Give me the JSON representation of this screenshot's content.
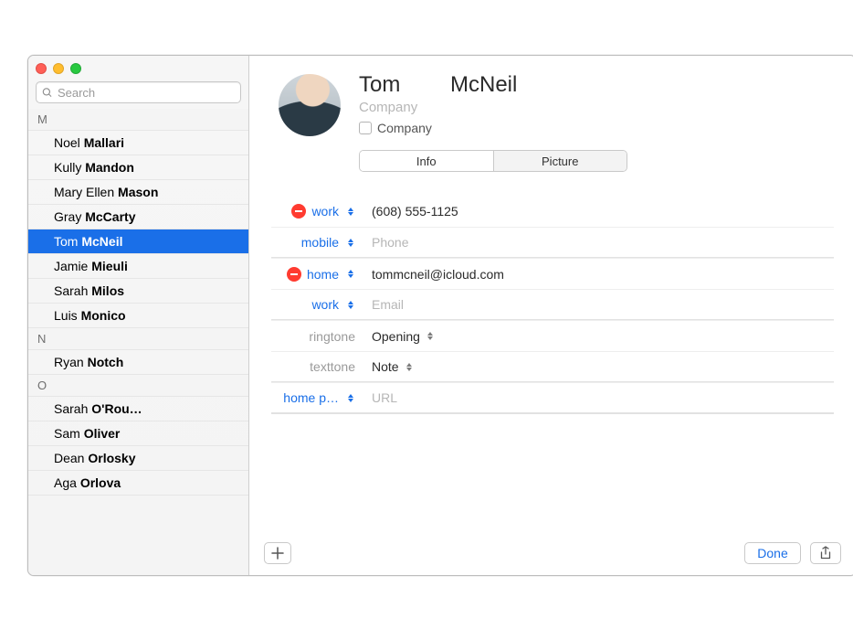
{
  "search": {
    "placeholder": "Search"
  },
  "sidebar": {
    "groups": [
      {
        "letter": "M",
        "items": [
          {
            "first": "Noel",
            "last": "Mallari"
          },
          {
            "first": "Kully",
            "last": "Mandon"
          },
          {
            "first": "Mary Ellen",
            "last": "Mason"
          },
          {
            "first": "Gray",
            "last": "McCarty"
          },
          {
            "first": "Tom",
            "last": "McNeil",
            "selected": true
          },
          {
            "first": "Jamie",
            "last": "Mieuli"
          },
          {
            "first": "Sarah",
            "last": "Milos"
          },
          {
            "first": "Luis",
            "last": "Monico"
          }
        ]
      },
      {
        "letter": "N",
        "items": [
          {
            "first": "Ryan",
            "last": "Notch"
          }
        ]
      },
      {
        "letter": "O",
        "items": [
          {
            "first": "Sarah",
            "last": "O'Rou…"
          },
          {
            "first": "Sam",
            "last": "Oliver"
          },
          {
            "first": "Dean",
            "last": "Orlosky"
          },
          {
            "first": "Aga",
            "last": "Orlova"
          }
        ]
      }
    ]
  },
  "card": {
    "first_name": "Tom",
    "last_name": "McNeil",
    "company_placeholder": "Company",
    "company_checkbox_label": "Company",
    "tabs": {
      "info": "Info",
      "picture": "Picture",
      "active": "info"
    },
    "fields": [
      {
        "kind": "phone",
        "label": "work",
        "label_color": "blue",
        "deletable": true,
        "value": "(608) 555-1125"
      },
      {
        "kind": "phone",
        "label": "mobile",
        "label_color": "blue",
        "deletable": false,
        "placeholder": "Phone",
        "group_end": true
      },
      {
        "kind": "email",
        "label": "home",
        "label_color": "blue",
        "deletable": true,
        "value": "tommcneil@icloud.com"
      },
      {
        "kind": "email",
        "label": "work",
        "label_color": "blue",
        "deletable": false,
        "placeholder": "Email",
        "group_end": true
      },
      {
        "kind": "ringtone",
        "label": "ringtone",
        "label_color": "gray",
        "deletable": false,
        "select_value": "Opening"
      },
      {
        "kind": "texttone",
        "label": "texttone",
        "label_color": "gray",
        "deletable": false,
        "select_value": "Note",
        "group_end": true
      },
      {
        "kind": "url",
        "label": "home p…",
        "label_color": "blue",
        "deletable": false,
        "placeholder": "URL",
        "group_end": true
      }
    ],
    "buttons": {
      "done": "Done"
    }
  }
}
